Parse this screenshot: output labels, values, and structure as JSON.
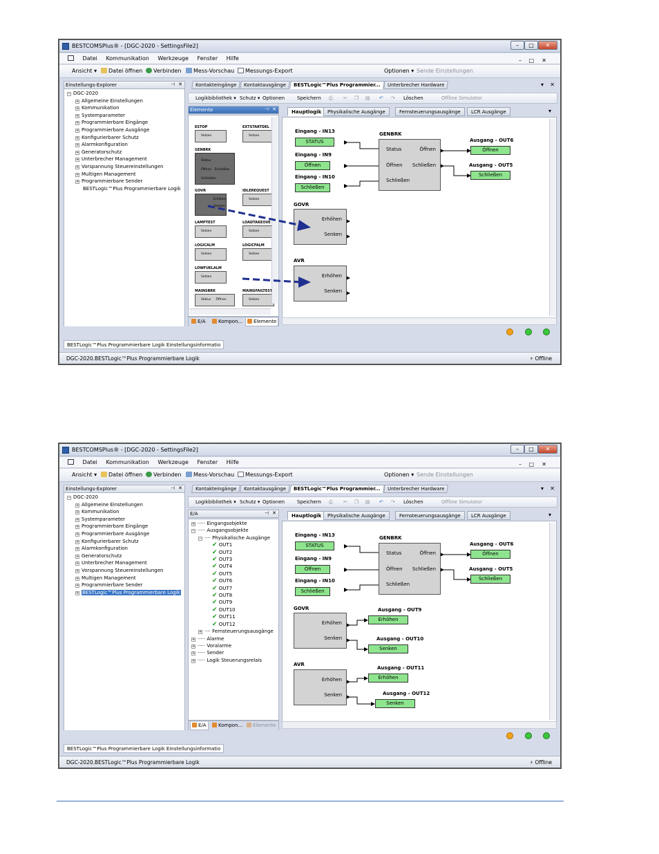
{
  "app": {
    "title": "BESTCOMSPlus® - [DGC-2020 - SettingsFile2]",
    "window_controls": {
      "min": "–",
      "max": "□",
      "close": "✕"
    }
  },
  "menu": [
    "Datei",
    "Kommunikation",
    "Werkzeuge",
    "Fenster",
    "Hilfe"
  ],
  "toolbar": {
    "ansicht": "Ansicht",
    "datei_oeffnen": "Datei öffnen",
    "verbinden": "Verbinden",
    "mess_vorschau": "Mess-Vorschau",
    "messungs_export": "Messungs-Export",
    "optionen": "Optionen",
    "sende_einstellungen": "Sende Einstellungen"
  },
  "explorer": {
    "title": "Einstellungs-Explorer",
    "root": "DGC-2020",
    "items": [
      "Allgemeine Einstellungen",
      "Kommunikation",
      "Systemparameter",
      "Programmierbare Eingänge",
      "Programmierbare Ausgänge",
      "Konfigurierbarer Schutz",
      "Alarmkonfiguration",
      "Generatorschutz",
      "Unterbrecher Management",
      "Vorspannung Steuereinstellungen",
      "Multigen Management",
      "Programmierbare Sender",
      "BESTLogic™Plus Programmierbare Logik"
    ]
  },
  "doc_tabs": [
    "Kontakteingänge",
    "Kontaktausgänge",
    "BESTLogic™Plus Programmier...",
    "Unterbrecher Hardware"
  ],
  "logic_toolbar": {
    "bibliothek": "Logikbibliothek",
    "schutz": "Schutz",
    "optionen": "Optionen",
    "speichern": "Speichern",
    "loeschen": "Löschen",
    "simulator": "Offline Simulator"
  },
  "diagram_tabs": [
    "Hauptlogik",
    "Physikalische Ausgänge",
    "Fernsteuerungsausgänge",
    "LCR Ausgänge"
  ],
  "pane_tabs": [
    "E/A",
    "Kompon...",
    "Elemente"
  ],
  "elements_panel": {
    "title": "Elemente",
    "items": [
      "ESTOP",
      "EXTSTARTDEL",
      "GENBRK",
      "GOVR",
      "IDLEREQUEST",
      "LAMPTEST",
      "LOADTAKEOVE",
      "LOGICALM",
      "LOGICFALM",
      "LOWFUELALM",
      "MAINSBRK",
      "MAINSFAILTEST"
    ],
    "setzen": "Setzen",
    "status": "Status",
    "oeffnen": "Öffnen",
    "schliessen": "Schließen",
    "erhoehen": "Erhöhen",
    "senken": "Senken"
  },
  "io_panel": {
    "title": "E/A",
    "eingangsobjekte": "Eingangsobjekte",
    "ausgangsobjekte": "Ausgangsobjekte",
    "physikalische": "Physikalische Ausgänge",
    "outs": [
      "OUT1",
      "OUT2",
      "OUT3",
      "OUT4",
      "OUT5",
      "OUT6",
      "OUT7",
      "OUT8",
      "OUT9",
      "OUT10",
      "OUT11",
      "OUT12"
    ],
    "fernsteuerung": "Fernsteuerungsausgänge",
    "alarme": "Alarme",
    "voralarme": "Voralarme",
    "sender": "Sender",
    "logik": "Logik Steuerungsrelais"
  },
  "diagram": {
    "in13_label": "Eingang - IN13",
    "in13_value": "STATUS",
    "in9_label": "Eingang - IN9",
    "in9_value": "Öffnen",
    "in10_label": "Eingang - IN10",
    "in10_value": "Schließen",
    "genbrk": "GENBRK",
    "genbrk_status": "Status",
    "genbrk_oeffnen_in": "Öffnen",
    "genbrk_schliessen_in": "Schließen",
    "genbrk_oeffnen_out": "Öffnen",
    "genbrk_schliessen_out": "Schließen",
    "out6_label": "Ausgang - OUT6",
    "out6_value": "Öffnen",
    "out5_label": "Ausgang - OUT5",
    "out5_value": "Schließen",
    "govr": "GOVR",
    "avr": "AVR",
    "erhoehen": "Erhöhen",
    "senken": "Senken",
    "out9_label": "Ausgang - OUT9",
    "out9_value": "Erhöhen",
    "out10_label": "Ausgang - OUT10",
    "out10_value": "Senken",
    "out11_label": "Ausgang - OUT11",
    "out11_value": "Erhöhen",
    "out12_label": "Ausgang - OUT12",
    "out12_value": "Senken"
  },
  "info_tab": "BESTLogic™Plus Programmierbare Logik Einstellungsinformatio",
  "status": {
    "path": "DGC-2020.BESTLogic™Plus Programmierbare Logik",
    "connection": "Offline"
  },
  "colors": {
    "accent": "#3a75c4",
    "led_orange": "#f2a21a",
    "led_green": "#3cc63c",
    "block_green": "#8ee58e",
    "arrow_blue": "#1f2f8f"
  }
}
